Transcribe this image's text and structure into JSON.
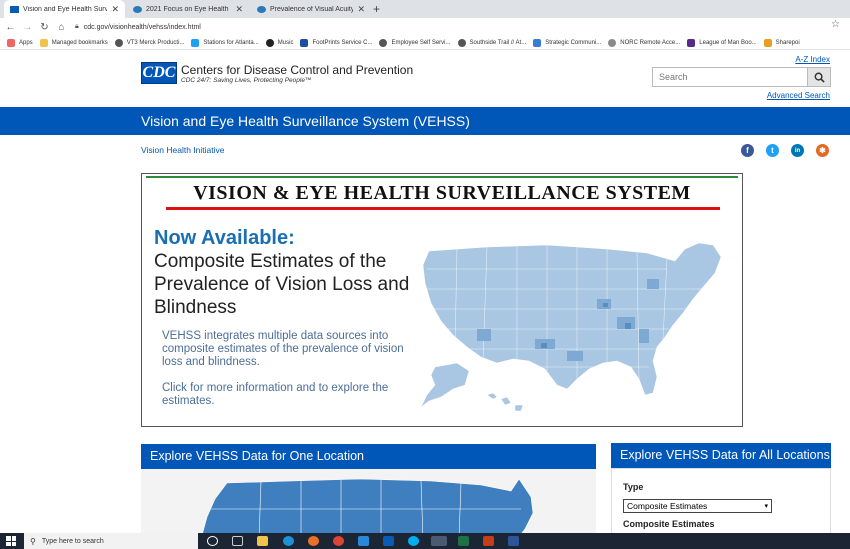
{
  "browser": {
    "tabs": [
      {
        "label": "Vision and Eye Health Surveillan",
        "active": true
      },
      {
        "label": "2021 Focus on Eye Health Nation",
        "active": false
      },
      {
        "label": "Prevalence of Visual Acuity Loss",
        "active": false
      }
    ],
    "new_tab": "+",
    "url": "cdc.gov/visionhealth/vehss/index.html",
    "bookmarks": [
      "Apps",
      "Managed bookmarks",
      "VT3 Merck Producti...",
      "Stations for Atlanta...",
      "Music",
      "FootPrints Service C...",
      "Employee Self Servi...",
      "Southside Trail // At...",
      "Strategic Communi...",
      "NORC Remote Acce...",
      "League of Man Boo...",
      "Sharepoi"
    ]
  },
  "header": {
    "logo": "CDC",
    "org_name": "Centers for Disease Control and Prevention",
    "tagline": "CDC 24/7: Saving Lives, Protecting People™",
    "az_index": "A-Z Index",
    "search_placeholder": "Search",
    "advanced_search": "Advanced Search"
  },
  "site_title": "Vision and Eye Health Surveillance System (VEHSS)",
  "breadcrumb": "Vision Health Initiative",
  "social": [
    {
      "name": "facebook",
      "glyph": "f",
      "color": "#3b5998"
    },
    {
      "name": "twitter",
      "glyph": "t",
      "color": "#1da1f2"
    },
    {
      "name": "linkedin",
      "glyph": "in",
      "color": "#0077b5"
    },
    {
      "name": "syndicate",
      "glyph": "✱",
      "color": "#e26a24"
    }
  ],
  "banner": {
    "title": "VISION & EYE HEALTH SURVEILLANCE SYSTEM",
    "now_available": "Now Available:",
    "headline": "Composite Estimates of the Prevalence of Vision Loss and Blindness",
    "description": "VEHSS integrates multiple data sources into composite estimates of the prevalence of vision loss and blindness.",
    "cta": "Click for more information and to explore the estimates."
  },
  "panels": {
    "left_title": "Explore VEHSS Data for One Location",
    "right_title": "Explore VEHSS Data for All Locations",
    "type_label": "Type",
    "type_selected": "Composite Estimates",
    "composite_label": "Composite Estimates"
  },
  "taskbar": {
    "search_placeholder": "Type here to search"
  },
  "colors": {
    "cdc_blue": "#0057b7",
    "accent_blue": "#1a6fb3",
    "map_fill": "#a9c6e3"
  }
}
